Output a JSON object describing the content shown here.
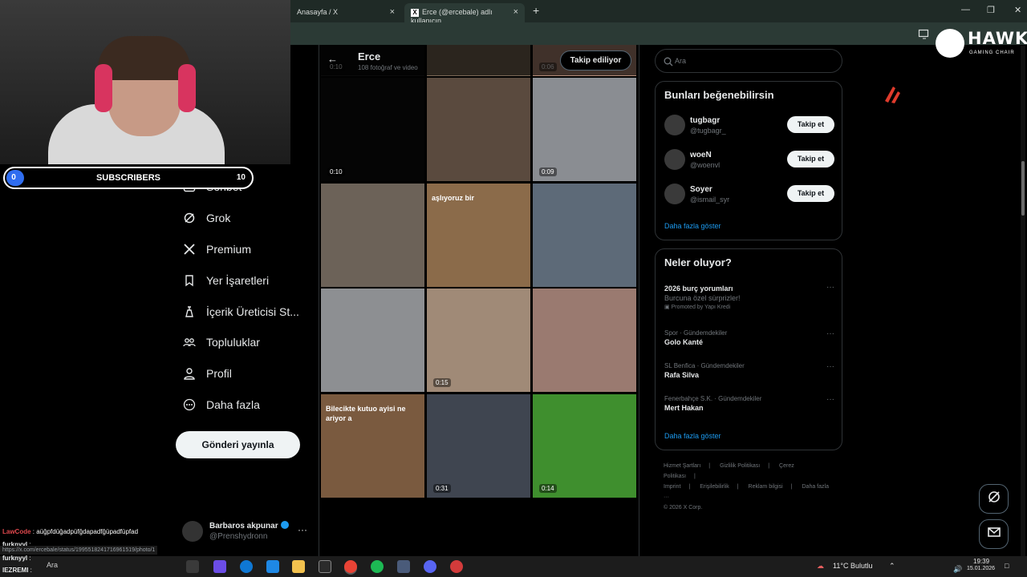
{
  "browser": {
    "tabs": [
      {
        "label": "Anasayfa / X",
        "close": "×"
      },
      {
        "label": "Erce (@ercebale) adlı kullanıcın...",
        "close": "×"
      }
    ],
    "new_tab": "+",
    "window_controls": [
      "—",
      "❐",
      "✕"
    ]
  },
  "stream_overlay": {
    "subscribers": {
      "current": "0",
      "label": "SUBSCRIBERS",
      "goal": "10",
      "progress": 0.0
    },
    "chat": [
      {
        "user": "LawCode",
        "sep": " : ",
        "message": "aüğpfdüğadpüfğdapadfğüpadfüpfad"
      },
      {
        "user": "furknyyl",
        "sep": " : ",
        "message": ""
      },
      {
        "user": "furknyyl",
        "sep": " : ",
        "message": ""
      },
      {
        "user": "IEZREMI",
        "sep": " : ",
        "message": ""
      }
    ],
    "url_tooltip": "https://x.com/ercebale/status/1995518241716961519/photo/1",
    "brand_word": "HAWK",
    "brand_tag": "GAMING CHAIR"
  },
  "nav": {
    "items": [
      {
        "label": "Sohbet",
        "icon": "chat-icon"
      },
      {
        "label": "Grok",
        "icon": "grok-icon"
      },
      {
        "label": "Premium",
        "icon": "x-logo-icon"
      },
      {
        "label": "Yer İşaretleri",
        "icon": "bookmark-icon"
      },
      {
        "label": "İçerik Üreticisi St...",
        "icon": "creator-studio-icon"
      },
      {
        "label": "Topluluklar",
        "icon": "communities-icon"
      },
      {
        "label": "Profil",
        "icon": "profile-icon"
      },
      {
        "label": "Daha fazla",
        "icon": "more-circle-icon"
      }
    ],
    "post_button": "Gönderi yayınla",
    "account": {
      "name": "Barbaros akpunar",
      "handle": "@Prenshydronn",
      "more": "···"
    }
  },
  "profile_header": {
    "back": "←",
    "name": "Erce",
    "subtitle": "108 fotoğraf ve video",
    "follow_state": "Takip ediliyor"
  },
  "media_grid": {
    "tiles": [
      {
        "duration": "0:10",
        "caption": "",
        "color": "#0b0b0b"
      },
      {
        "duration": "",
        "caption": "",
        "color": "#7d6a58"
      },
      {
        "duration": "0:06",
        "caption": "",
        "color": "#b78e7a"
      },
      {
        "duration": "0:10",
        "caption": "",
        "color": "#050505"
      },
      {
        "duration": "",
        "caption": "",
        "color": "#5a4a3e"
      },
      {
        "duration": "0:09",
        "caption": "",
        "color": "#8a8d92"
      },
      {
        "duration": "",
        "caption": "",
        "color": "#6c6258"
      },
      {
        "duration": "",
        "caption": "aşlıyoruz bir",
        "color": "#8b6b4a"
      },
      {
        "duration": "",
        "caption": "",
        "color": "#5d6a78"
      },
      {
        "duration": "",
        "caption": "",
        "color": "#8d8f92"
      },
      {
        "duration": "0:15",
        "caption": "",
        "color": "#a08a77"
      },
      {
        "duration": "",
        "caption": "",
        "color": "#9a7a70"
      },
      {
        "duration": "",
        "caption": "Bilecikte kutuo ayisi ne ariyor a",
        "color": "#7a5a3f"
      },
      {
        "duration": "0:31",
        "caption": "",
        "color": "#3f4550"
      },
      {
        "duration": "0:14",
        "caption": "",
        "color": "#3f8f2e"
      }
    ]
  },
  "sidebar": {
    "search_placeholder": "Ara",
    "who_to_follow": {
      "title": "Bunları beğenebilirsin",
      "users": [
        {
          "name": "tugbagr",
          "handle": "@tugbagr_",
          "button": "Takip et"
        },
        {
          "name": "woeN",
          "handle": "@woenvl",
          "button": "Takip et"
        },
        {
          "name": "Soyer",
          "handle": "@ismail_syr",
          "button": "Takip et"
        }
      ],
      "more": "Daha fazla göster"
    },
    "whats_happening": {
      "title": "Neler oluyor?",
      "trends": [
        {
          "context": "",
          "title": "2026 burç yorumları",
          "desc": "Burcuna özel sürprizler!",
          "promo": "Promoted by Yapı Kredi"
        },
        {
          "context": "Spor · Gündemdekiler",
          "title": "Golo Kanté",
          "desc": "",
          "promo": ""
        },
        {
          "context": "SL Benfica · Gündemdekiler",
          "title": "Rafa Silva",
          "desc": "",
          "promo": ""
        },
        {
          "context": "Fenerbahçe S.K. · Gündemdekiler",
          "title": "Mert Hakan",
          "desc": "",
          "promo": ""
        }
      ],
      "dots": "···",
      "more": "Daha fazla göster"
    },
    "footer_links": [
      "Hizmet Şartları",
      "|",
      "Gizlilik Politikası",
      "|",
      "Çerez Politikası",
      "|",
      "Imprint",
      "|",
      "Erişilebilirlik",
      "|",
      "Reklam bilgisi",
      "|",
      "Daha fazla ···",
      "© 2026 X Corp."
    ]
  },
  "taskbar": {
    "search_placeholder": "Ara",
    "weather": "11°C  Bulutlu",
    "time": "19:39",
    "date": "15.01.2026"
  }
}
